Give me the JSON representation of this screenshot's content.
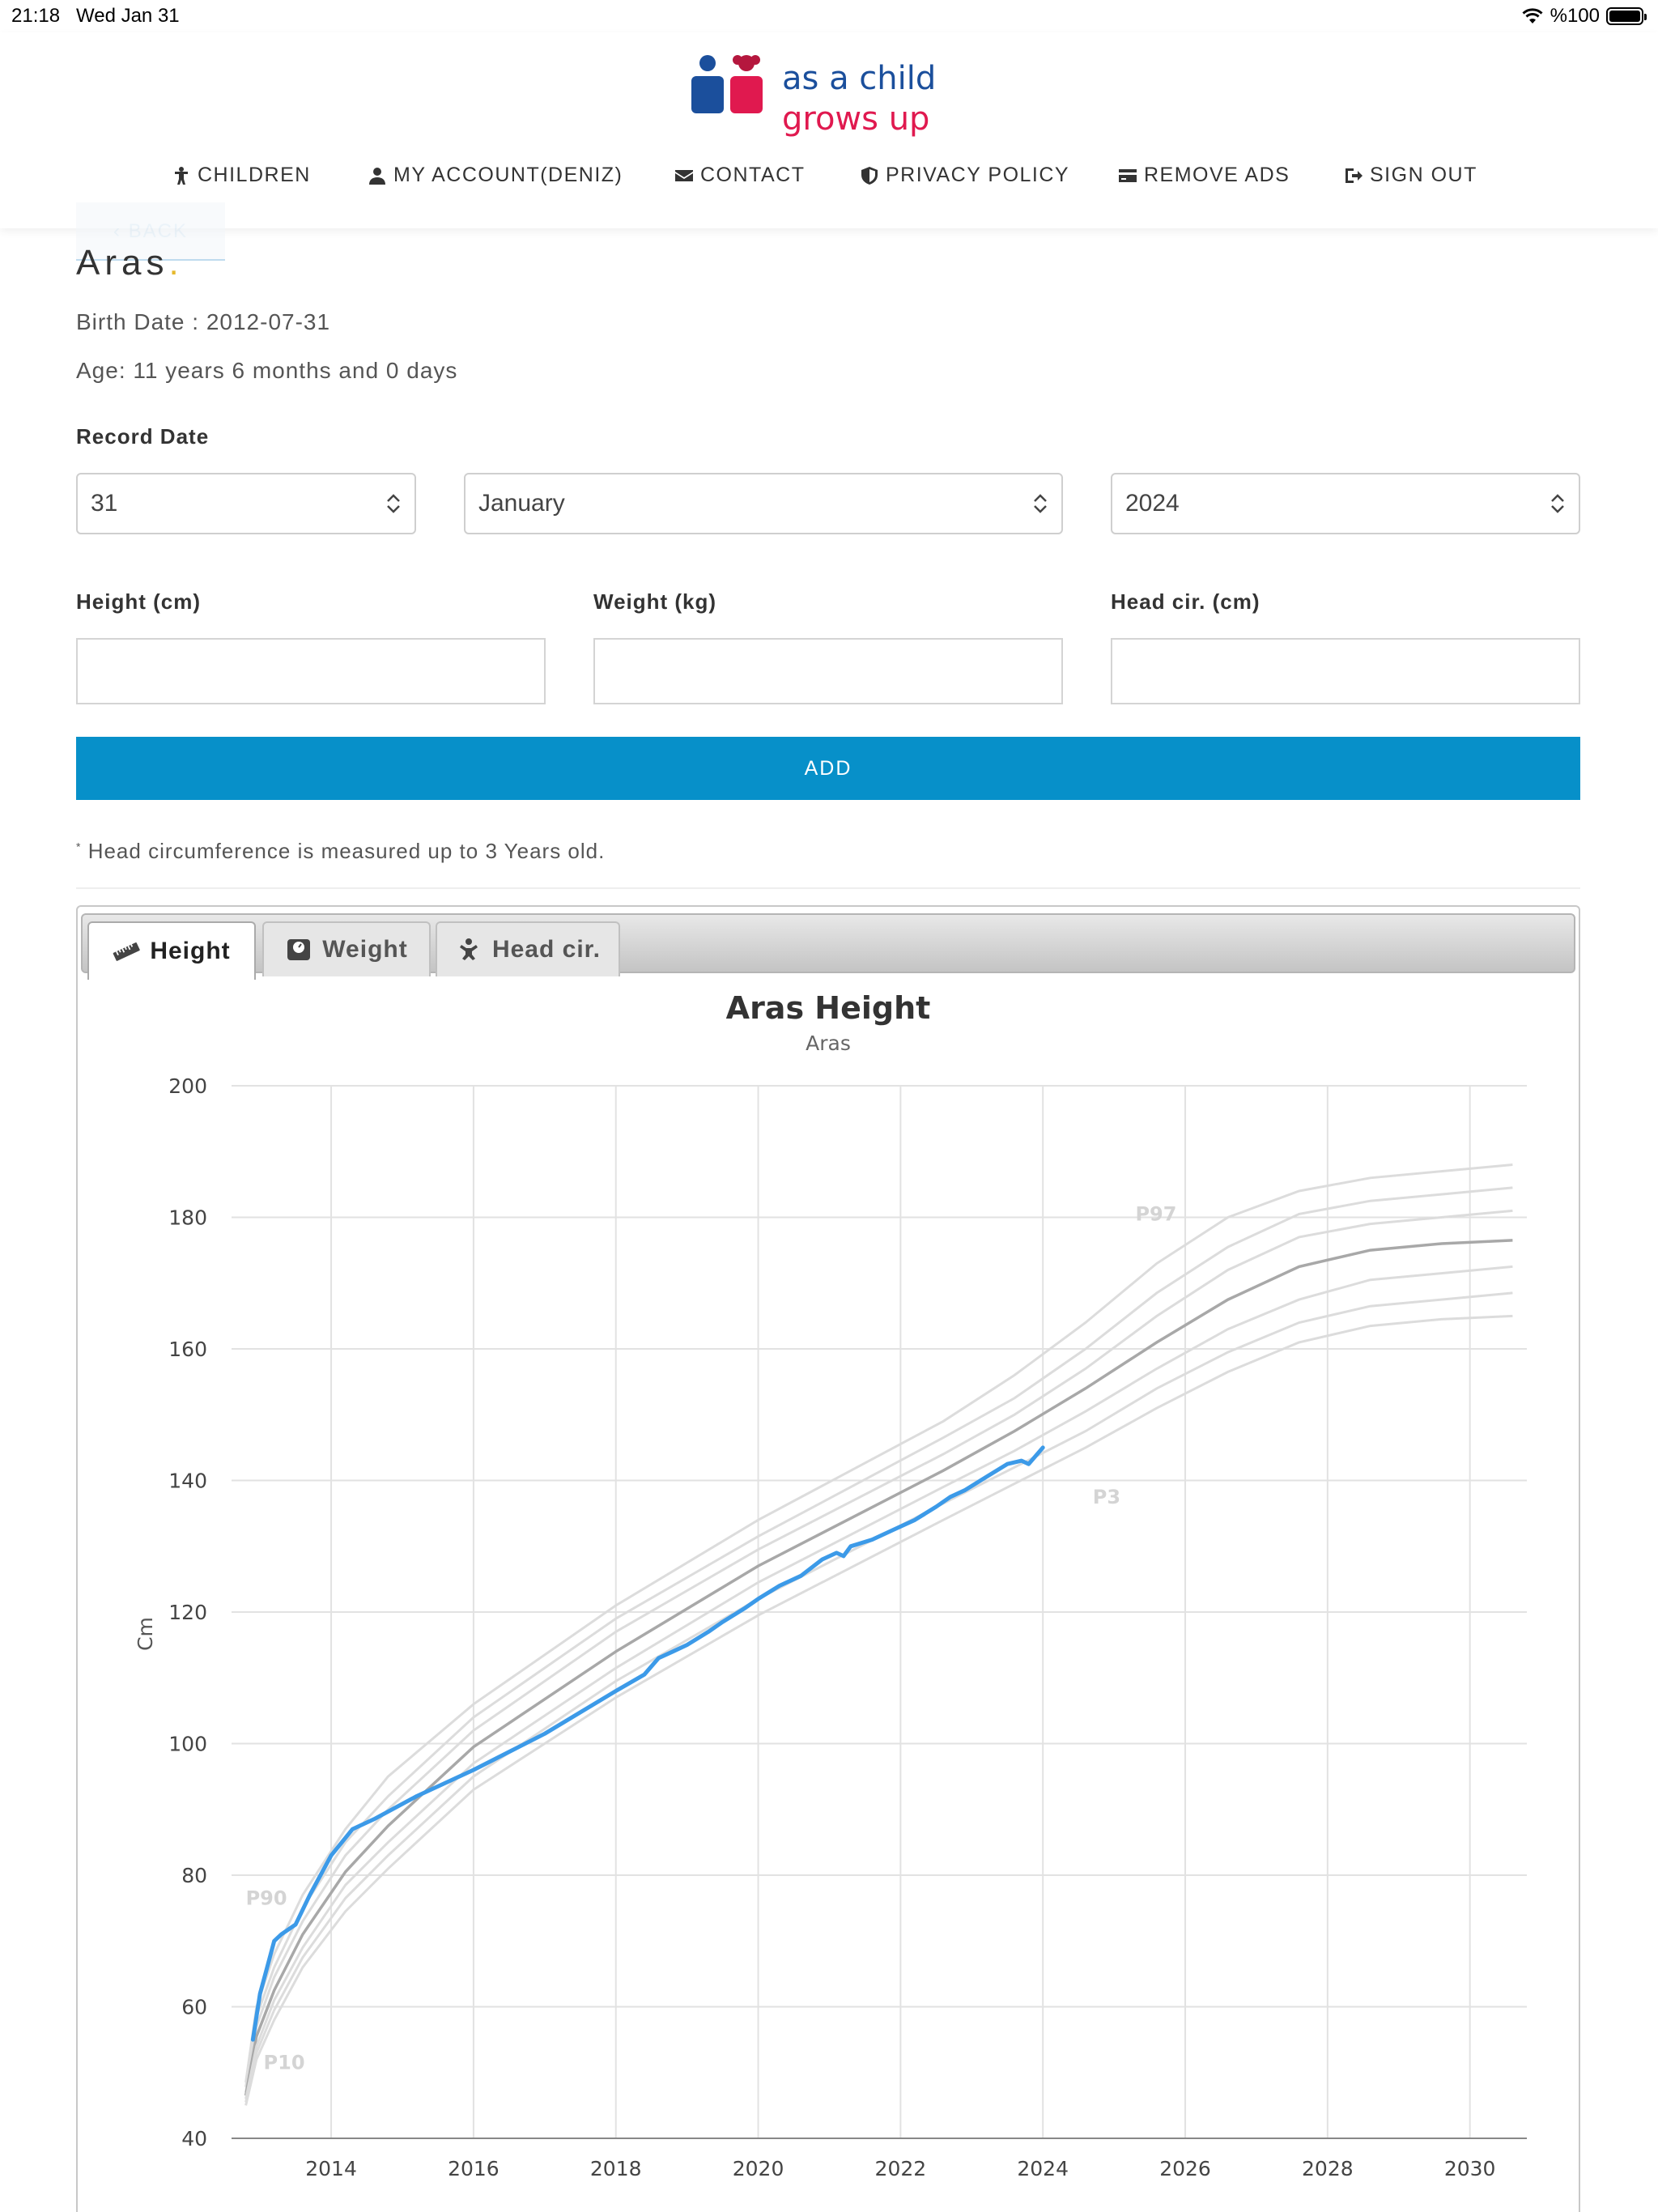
{
  "status_bar": {
    "time": "21:18",
    "date": "Wed Jan 31",
    "battery": "%100"
  },
  "logo": {
    "line1": "as a child",
    "line2": "grows up"
  },
  "nav": [
    {
      "label": "CHILDREN",
      "icon": "child-icon"
    },
    {
      "label": "MY ACCOUNT(DENIZ)",
      "icon": "user-icon"
    },
    {
      "label": "CONTACT",
      "icon": "envelope-icon"
    },
    {
      "label": "PRIVACY POLICY",
      "icon": "shield-icon"
    },
    {
      "label": "REMOVE ADS",
      "icon": "credit-card-icon"
    },
    {
      "label": "SIGN OUT",
      "icon": "sign-out-icon"
    }
  ],
  "back_label": "BACK",
  "child": {
    "name": "Aras",
    "birth_date_text": "Birth Date : 2012-07-31",
    "age_text": "Age: 11 years 6 months and 0 days"
  },
  "form": {
    "record_date_label": "Record Date",
    "day": "31",
    "month": "January",
    "year": "2024",
    "height_label": "Height (cm)",
    "weight_label": "Weight (kg)",
    "head_label": "Head cir. (cm)",
    "add_label": "ADD",
    "note": "Head circumference is measured up to 3 Years old.",
    "note_marker": "*"
  },
  "tabs": [
    {
      "label": "Height",
      "icon": "ruler-icon",
      "active": true
    },
    {
      "label": "Weight",
      "icon": "scale-icon",
      "active": false
    },
    {
      "label": "Head cir.",
      "icon": "baby-icon",
      "active": false
    }
  ],
  "chart_data": {
    "type": "line",
    "title": "Aras Height",
    "subtitle": "Aras",
    "ylabel": "Cm",
    "xlabel": "",
    "ylim": [
      40,
      200
    ],
    "xlim": [
      2012.6,
      2030.8
    ],
    "yticks": [
      40,
      60,
      80,
      100,
      120,
      140,
      160,
      180,
      200
    ],
    "xticks": [
      2014,
      2016,
      2018,
      2020,
      2022,
      2024,
      2026,
      2028,
      2030
    ],
    "grid": true,
    "percentile_labels": [
      {
        "text": "P97",
        "x": 2025.3,
        "y": 179.5
      },
      {
        "text": "P3",
        "x": 2024.7,
        "y": 136.5
      },
      {
        "text": "P90",
        "x": 2012.8,
        "y": 75.5
      },
      {
        "text": "P10",
        "x": 2013.05,
        "y": 50.5
      }
    ],
    "colors": {
      "child": "#3c9ae8",
      "median": "#a8a8a8",
      "percentile": "#dcdcdc"
    },
    "percentiles": [
      {
        "x": [
          2012.8,
          2012.95,
          2013.2,
          2013.6,
          2014.2,
          2014.8,
          2016,
          2018,
          2020,
          2022.6,
          2023.6,
          2024.6,
          2025.6,
          2026.6,
          2027.6,
          2028.6,
          2029.6,
          2030.6
        ],
        "values": [
          48.5,
          60,
          68,
          77,
          87,
          95,
          106,
          121,
          134,
          149,
          156,
          164,
          173,
          180,
          184,
          186,
          187,
          188
        ]
      },
      {
        "x": [
          2012.8,
          2012.95,
          2013.2,
          2013.6,
          2014.2,
          2014.8,
          2016,
          2018,
          2020,
          2022.6,
          2023.6,
          2024.6,
          2025.6,
          2026.6,
          2027.6,
          2028.6,
          2029.6,
          2030.6
        ],
        "values": [
          47.8,
          58.5,
          66,
          75,
          85,
          92,
          104,
          119,
          131.5,
          146.5,
          152.5,
          160,
          168.5,
          175.5,
          180.5,
          182.5,
          183.5,
          184.5
        ]
      },
      {
        "x": [
          2012.8,
          2012.95,
          2013.2,
          2013.6,
          2014.2,
          2014.8,
          2016,
          2018,
          2020,
          2022.6,
          2023.6,
          2024.6,
          2025.6,
          2026.6,
          2027.6,
          2028.6,
          2029.6,
          2030.6
        ],
        "values": [
          47,
          57,
          64.5,
          73,
          83,
          90,
          102,
          117,
          129.5,
          144,
          150,
          157,
          165,
          172,
          177,
          179,
          180,
          181
        ]
      },
      {
        "x": [
          2012.8,
          2012.95,
          2013.2,
          2013.6,
          2014.2,
          2014.8,
          2016,
          2018,
          2020,
          2022.6,
          2023.6,
          2024.6,
          2025.6,
          2026.6,
          2027.6,
          2028.6,
          2029.6,
          2030.6
        ],
        "values": [
          46.5,
          55.5,
          62.5,
          71,
          80.5,
          87.5,
          99.5,
          114,
          127,
          141.5,
          147.5,
          154,
          161,
          167.5,
          172.5,
          175,
          176,
          176.5
        ]
      },
      {
        "x": [
          2012.8,
          2012.95,
          2013.2,
          2013.6,
          2014.2,
          2014.8,
          2016,
          2018,
          2020,
          2022.6,
          2023.6,
          2024.6,
          2025.6,
          2026.6,
          2027.6,
          2028.6,
          2029.6,
          2030.6
        ],
        "values": [
          46,
          54,
          61,
          69,
          78.5,
          85,
          97,
          111.5,
          124.5,
          139,
          144.5,
          150.5,
          157,
          163,
          167.5,
          170.5,
          171.5,
          172.5
        ]
      },
      {
        "x": [
          2012.8,
          2012.95,
          2013.2,
          2013.6,
          2014.2,
          2014.8,
          2016,
          2018,
          2020,
          2022.6,
          2023.6,
          2024.6,
          2025.6,
          2026.6,
          2027.6,
          2028.6,
          2029.6,
          2030.6
        ],
        "values": [
          45.5,
          53,
          59.5,
          67.5,
          76.5,
          83,
          95,
          109.5,
          122,
          136.5,
          142,
          147.5,
          154,
          159.5,
          164,
          166.5,
          167.5,
          168.5
        ]
      },
      {
        "x": [
          2012.8,
          2012.95,
          2013.2,
          2013.6,
          2014.2,
          2014.8,
          2016,
          2018,
          2020,
          2022.6,
          2023.6,
          2024.6,
          2025.6,
          2026.6,
          2027.6,
          2028.6,
          2029.6,
          2030.6
        ],
        "values": [
          45,
          52,
          58,
          66,
          74.5,
          81,
          93,
          107,
          119.5,
          134,
          139.5,
          145,
          151,
          156.5,
          161,
          163.5,
          164.5,
          165
        ]
      }
    ],
    "median_index": 3,
    "series": [
      {
        "x": [
          2012.9,
          2013.0,
          2013.1,
          2013.2,
          2013.3,
          2013.5,
          2013.7,
          2014.0,
          2014.3,
          2014.6,
          2015.2,
          2016.0,
          2017.0,
          2018.0,
          2018.4,
          2018.6,
          2018.8,
          2019.0,
          2019.3,
          2019.5,
          2019.8,
          2020.0,
          2020.3,
          2020.6,
          2020.9,
          2021.1,
          2021.2,
          2021.3,
          2021.6,
          2021.9,
          2022.2,
          2022.5,
          2022.7,
          2022.9,
          2023.2,
          2023.5,
          2023.7,
          2023.8,
          2024.0
        ],
        "values": [
          55,
          62,
          66,
          70,
          71,
          72.5,
          77,
          83,
          87,
          88.5,
          92,
          96,
          101.5,
          108,
          110.5,
          113,
          114,
          115,
          117,
          118.5,
          120.5,
          122,
          124,
          125.5,
          128,
          129,
          128.5,
          130,
          131,
          132.5,
          134,
          136,
          137.5,
          138.5,
          140.5,
          142.5,
          143,
          142.5,
          145
        ]
      }
    ]
  }
}
